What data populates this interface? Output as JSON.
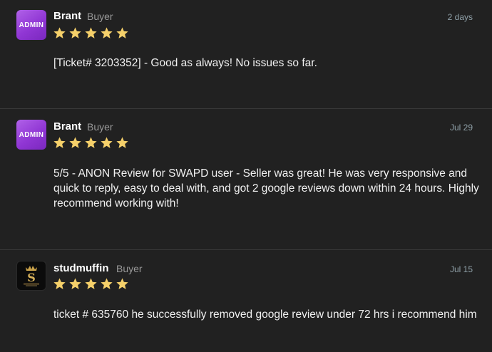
{
  "colors": {
    "background": "#212121",
    "star": "#f5d06a",
    "admin_avatar": "#9a3fd8",
    "muted": "#9a9a9a"
  },
  "reviews": [
    {
      "avatar_text": "ADMIN",
      "username": "Brant",
      "role": "Buyer",
      "date": "2 days",
      "rating": 5,
      "text": "[Ticket# 3203352] - Good as always! No issues so far."
    },
    {
      "avatar_text": "ADMIN",
      "username": "Brant",
      "role": "Buyer",
      "date": "Jul 29",
      "rating": 5,
      "text": "5/5 - ANON Review for SWAPD user - Seller was great! He was very responsive and quick to reply, easy to deal with, and got 2 google reviews down within 24 hours. Highly recommend working with!"
    },
    {
      "avatar_icon": "studmuffin-logo-icon",
      "username": "studmuffin",
      "role": "Buyer",
      "date": "Jul 15",
      "rating": 5,
      "text": "ticket # 635760 he successfully removed google review under 72 hrs i recommend him"
    }
  ]
}
